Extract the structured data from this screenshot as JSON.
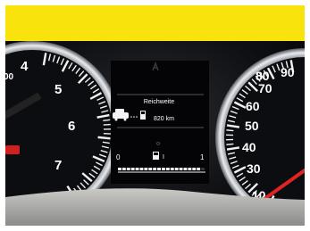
{
  "photo": {
    "colors": {
      "banner": "#f8e30c",
      "needle": "#e02424",
      "dial_numbers": "#ffffff",
      "lcd_background": "#050507"
    },
    "tachometer": {
      "ticks": [
        "00",
        "4",
        "5",
        "6",
        "7"
      ],
      "reading_pct_of_range": 0
    },
    "speedometer": {
      "ticks": [
        "90",
        "80",
        "70",
        "60",
        "50",
        "40",
        "30",
        "10"
      ],
      "needle": "near 0"
    },
    "display": {
      "title": "Reichweite",
      "range_value": "820 km",
      "fuel_gauge": {
        "min_label": "0",
        "max_label": "1",
        "half_label": "I",
        "level_fraction": 0.95
      }
    }
  }
}
